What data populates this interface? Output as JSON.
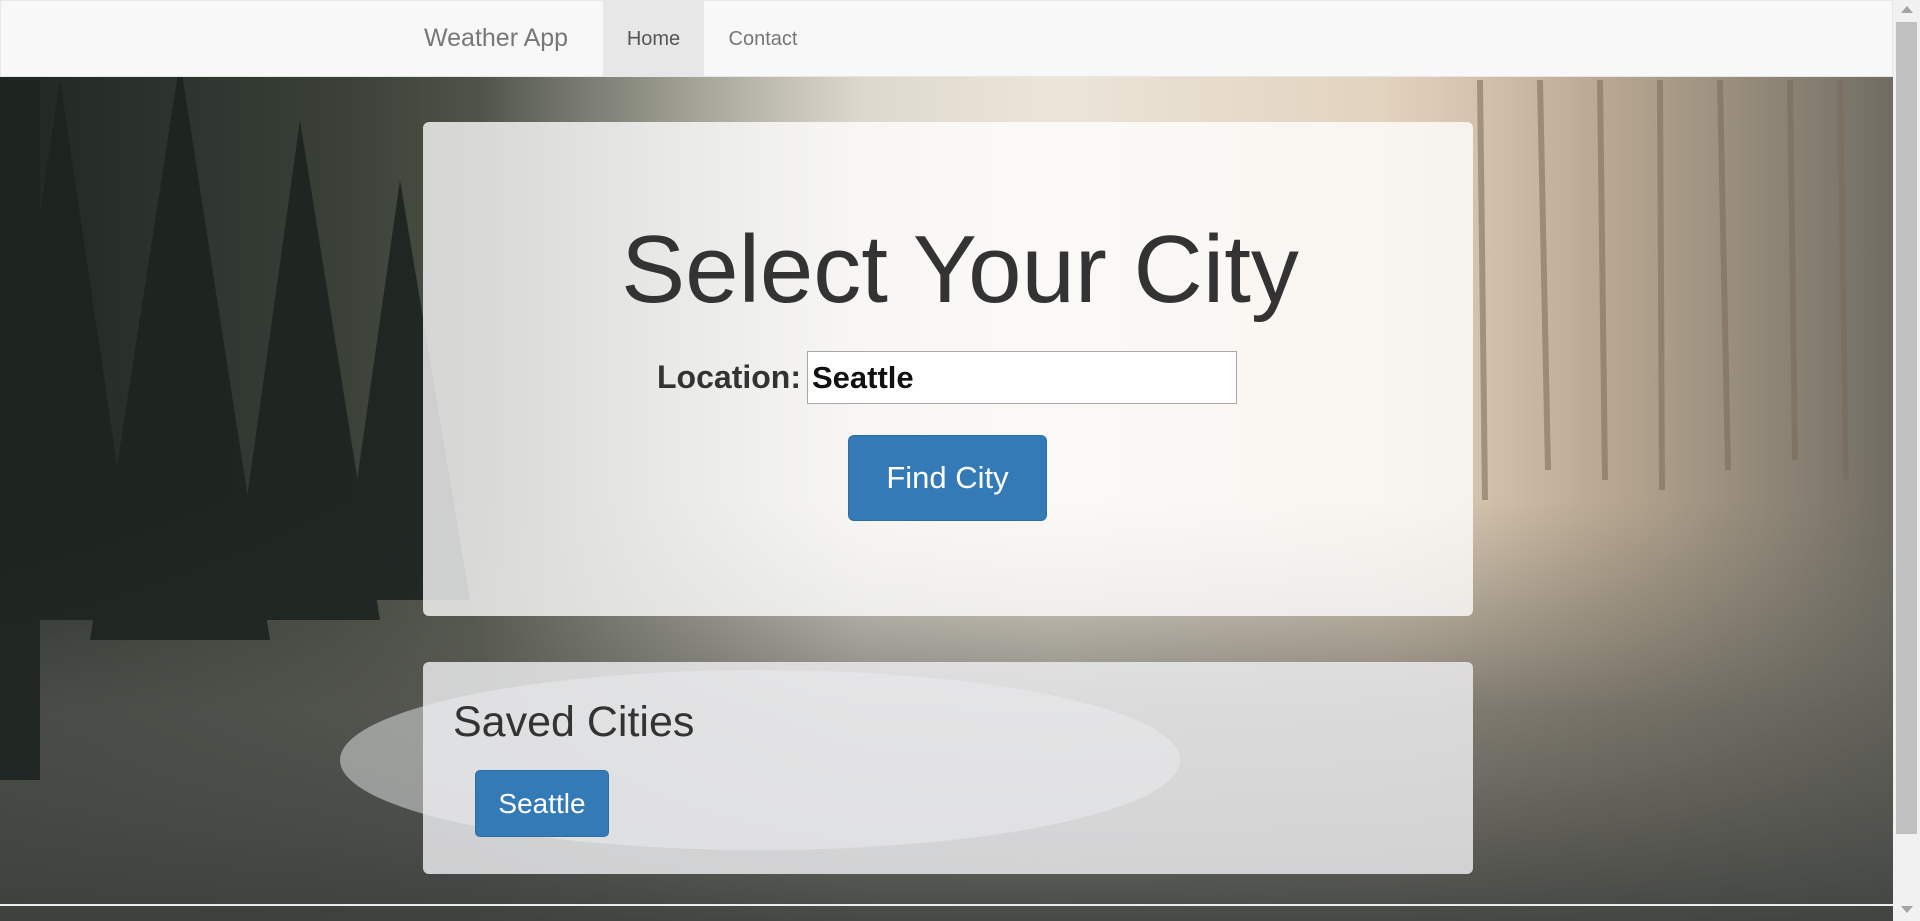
{
  "navbar": {
    "brand": "Weather App",
    "items": [
      {
        "label": "Home",
        "active": true
      },
      {
        "label": "Contact",
        "active": false
      }
    ]
  },
  "search": {
    "title": "Select Your City",
    "location_label": "Location:",
    "location_value": "Seattle",
    "button_label": "Find City"
  },
  "saved": {
    "title": "Saved Cities",
    "cities": [
      "Seattle"
    ]
  },
  "colors": {
    "primary_button": "#337ab7",
    "navbar_bg": "#f8f8f8",
    "active_nav_bg": "#e7e7e7",
    "text": "#333333"
  },
  "background": {
    "icon": "foggy-forest-photo"
  }
}
